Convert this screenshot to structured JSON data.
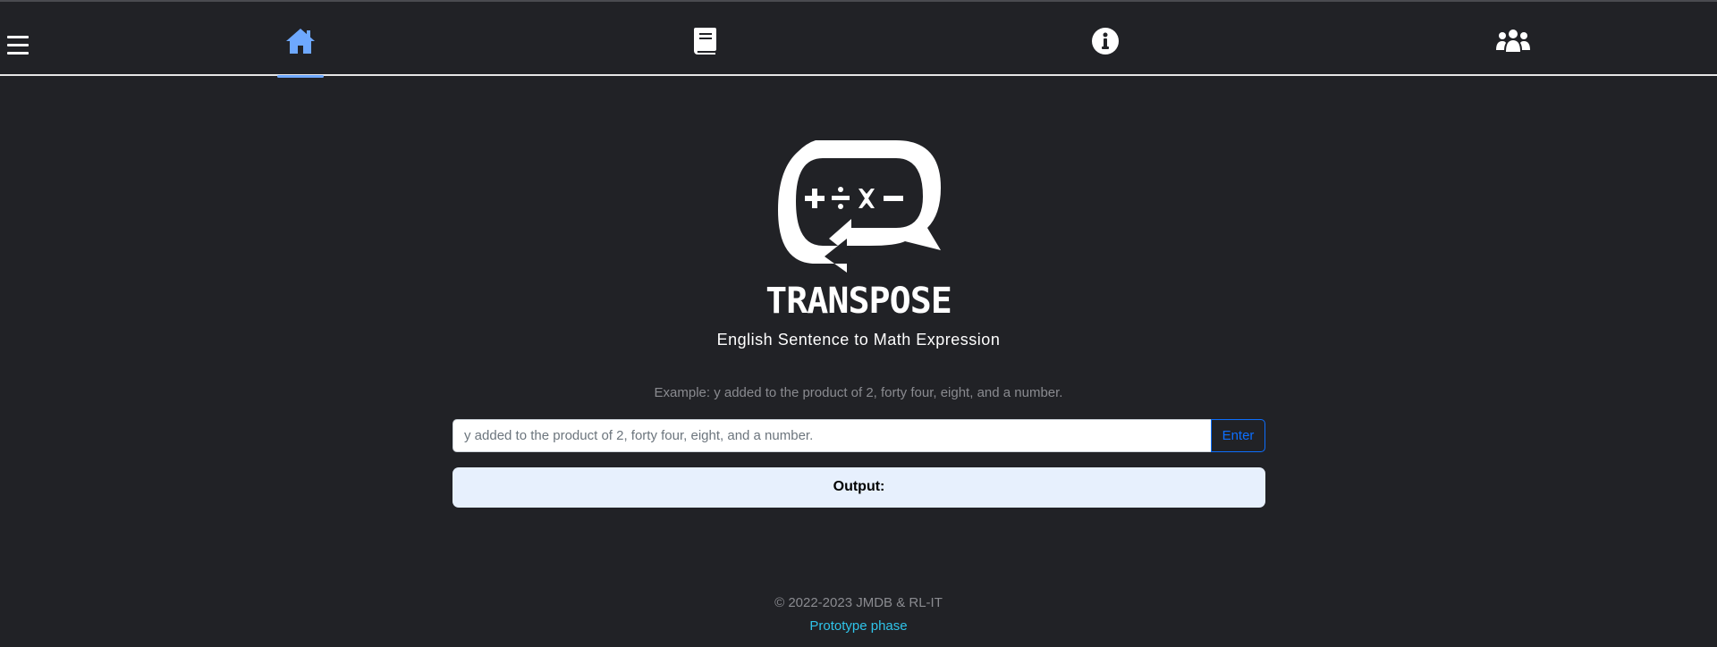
{
  "nav": {
    "menu_icon": "hamburger-icon",
    "items": [
      {
        "icon": "home-icon",
        "active": true
      },
      {
        "icon": "book-icon",
        "active": false
      },
      {
        "icon": "info-circle-icon",
        "active": false
      },
      {
        "icon": "users-icon",
        "active": false
      }
    ],
    "active_color": "#6ea8fe"
  },
  "logo": {
    "name": "TRANSPOSE",
    "symbols": "+ ÷ × −"
  },
  "subtitle": "English Sentence to Math Expression",
  "example": "Example: y added to the product of 2, forty four, eight, and a number.",
  "input": {
    "placeholder": "y added to the product of 2, forty four, eight, and a number.",
    "value": ""
  },
  "enter_label": "Enter",
  "output_label": "Output:",
  "footer": {
    "copyright": "© 2022-2023 JMDB & RL-IT",
    "phase": "Prototype phase"
  },
  "colors": {
    "background": "#212226",
    "accent": "#6ea8fe",
    "button": "#0d6efd",
    "output_bg": "#e7f0fd",
    "phase_link": "#2fc4ea"
  }
}
